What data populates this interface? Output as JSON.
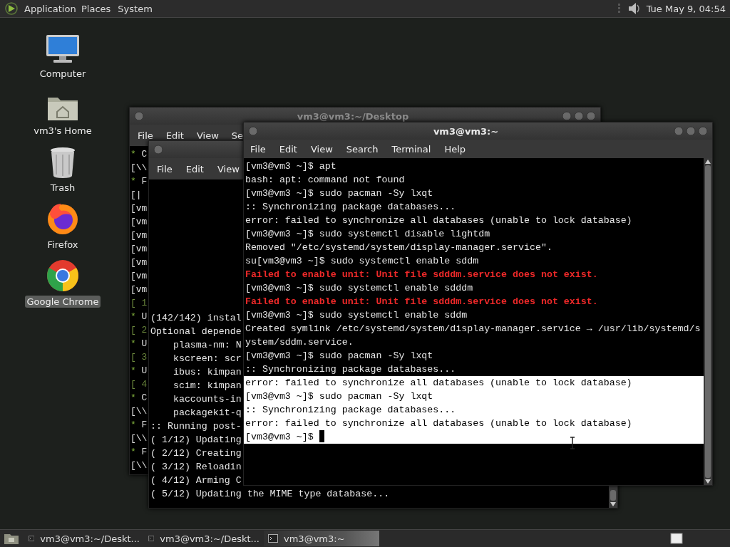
{
  "top_panel": {
    "menus": [
      "Application",
      "Places",
      "System"
    ],
    "clock": "Tue May 9, 04:54"
  },
  "desktop_icons": [
    {
      "label": "Computer",
      "kind": "computer",
      "selected": false
    },
    {
      "label": "vm3's Home",
      "kind": "home",
      "selected": false
    },
    {
      "label": "Trash",
      "kind": "trash",
      "selected": false
    },
    {
      "label": "Firefox",
      "kind": "firefox",
      "selected": false
    },
    {
      "label": "Google Chrome",
      "kind": "chrome",
      "selected": true
    }
  ],
  "windows": [
    {
      "title": "vm3@vm3:~/Desktop",
      "focused": false,
      "menu": [
        "File",
        "Edit",
        "View",
        "Se"
      ],
      "lines": [
        {
          "kind": "bullet",
          "mark": "*",
          "text": "C"
        },
        {
          "kind": "plain",
          "text": "[\\\\"
        },
        {
          "kind": "bullet",
          "mark": "*",
          "text": "F"
        },
        {
          "kind": "plain",
          "text": "[|"
        },
        {
          "kind": "plain",
          "text": "[vm"
        },
        {
          "kind": "plain",
          "text": "[vm"
        },
        {
          "kind": "plain",
          "text": "[vm"
        },
        {
          "kind": "plain",
          "text": "[vm"
        },
        {
          "kind": "plain",
          "text": "[vm"
        },
        {
          "kind": "plain",
          "text": "[vm"
        },
        {
          "kind": "plain",
          "text": "[vm"
        },
        {
          "kind": "status",
          "text": "[ 1"
        },
        {
          "kind": "bullet",
          "mark": "*",
          "text": "U"
        },
        {
          "kind": "status",
          "text": "[ 2"
        },
        {
          "kind": "bullet",
          "mark": "*",
          "text": "U"
        },
        {
          "kind": "status",
          "text": "[ 3"
        },
        {
          "kind": "bullet",
          "mark": "*",
          "text": "U"
        },
        {
          "kind": "status",
          "text": "[ 4"
        },
        {
          "kind": "bullet",
          "mark": "*",
          "text": "C"
        },
        {
          "kind": "plain",
          "text": "[\\\\"
        },
        {
          "kind": "bullet",
          "mark": "*",
          "text": "F"
        },
        {
          "kind": "plain",
          "text": "[\\\\"
        },
        {
          "kind": "bullet",
          "mark": "*",
          "text": "F"
        },
        {
          "kind": "plain",
          "text": "[\\\\"
        }
      ]
    },
    {
      "menu": [
        "File",
        "Edit",
        "View"
      ],
      "lines": [
        {
          "kind": "plain",
          "text": "(142/142) instal"
        },
        {
          "kind": "plain",
          "text": "Optional depende"
        },
        {
          "kind": "plain",
          "text": "    plasma-nm: N"
        },
        {
          "kind": "plain",
          "text": "    kscreen: scr"
        },
        {
          "kind": "plain",
          "text": "    ibus: kimpan"
        },
        {
          "kind": "plain",
          "text": "    scim: kimpan"
        },
        {
          "kind": "plain",
          "text": "    kaccounts-in"
        },
        {
          "kind": "plain",
          "text": "    packagekit-q"
        },
        {
          "kind": "plain",
          "text": ":: Running post-"
        },
        {
          "kind": "plain",
          "text": "( 1/12) Updating"
        },
        {
          "kind": "plain",
          "text": "( 2/12) Creating"
        },
        {
          "kind": "plain",
          "text": "( 3/12) Reloadin"
        },
        {
          "kind": "plain",
          "text": "( 4/12) Arming C"
        },
        {
          "kind": "plain",
          "text": "( 5/12) Updating the MIME type database..."
        }
      ]
    },
    {
      "title": "vm3@vm3:~",
      "focused": true,
      "menu": [
        "File",
        "Edit",
        "View",
        "Search",
        "Terminal",
        "Help"
      ],
      "lines": [
        {
          "kind": "plain",
          "selected": false,
          "text": "[vm3@vm3 ~]$ apt"
        },
        {
          "kind": "plain",
          "selected": false,
          "text": "bash: apt: command not found"
        },
        {
          "kind": "plain",
          "selected": false,
          "text": "[vm3@vm3 ~]$ sudo pacman -Sy lxqt"
        },
        {
          "kind": "plain",
          "selected": false,
          "text": ":: Synchronizing package databases..."
        },
        {
          "kind": "plain",
          "selected": false,
          "text": "error: failed to synchronize all databases (unable to lock database)"
        },
        {
          "kind": "plain",
          "selected": false,
          "text": "[vm3@vm3 ~]$ sudo systemctl disable lightdm"
        },
        {
          "kind": "plain",
          "selected": false,
          "text": "Removed \"/etc/systemd/system/display-manager.service\"."
        },
        {
          "kind": "plain",
          "selected": false,
          "text": "su[vm3@vm3 ~]$ sudo systemctl enable sddm"
        },
        {
          "kind": "error",
          "selected": false,
          "text": "Failed to enable unit: Unit file sdddm.service does not exist."
        },
        {
          "kind": "plain",
          "selected": false,
          "text": "[vm3@vm3 ~]$ sudo systemctl enable sdddm"
        },
        {
          "kind": "error",
          "selected": false,
          "text": "Failed to enable unit: Unit file sdddm.service does not exist."
        },
        {
          "kind": "plain",
          "selected": false,
          "text": "[vm3@vm3 ~]$ sudo systemctl enable sddm"
        },
        {
          "kind": "plain",
          "selected": false,
          "text": "Created symlink /etc/systemd/system/display-manager.service → /usr/lib/systemd/s"
        },
        {
          "kind": "plain",
          "selected": false,
          "text": "ystem/sddm.service."
        },
        {
          "kind": "plain",
          "selected": false,
          "text": "[vm3@vm3 ~]$ sudo pacman -Sy lxqt"
        },
        {
          "kind": "plain",
          "selected": false,
          "text": ":: Synchronizing package databases..."
        },
        {
          "kind": "plain",
          "selected": true,
          "text": "error: failed to synchronize all databases (unable to lock database)"
        },
        {
          "kind": "plain",
          "selected": true,
          "text": "[vm3@vm3 ~]$ sudo pacman -Sy lxqt"
        },
        {
          "kind": "plain",
          "selected": true,
          "text": ":: Synchronizing package databases..."
        },
        {
          "kind": "plain",
          "selected": true,
          "text": "error: failed to synchronize all databases (unable to lock database)"
        },
        {
          "kind": "prompt",
          "selected": true,
          "text": "[vm3@vm3 ~]$ "
        }
      ]
    }
  ],
  "taskbar": {
    "tasks": [
      {
        "label": "vm3@vm3:~/Deskt...",
        "selected": false
      },
      {
        "label": "vm3@vm3:~/Deskt...",
        "selected": false
      },
      {
        "label": "vm3@vm3:~",
        "selected": true
      }
    ]
  }
}
